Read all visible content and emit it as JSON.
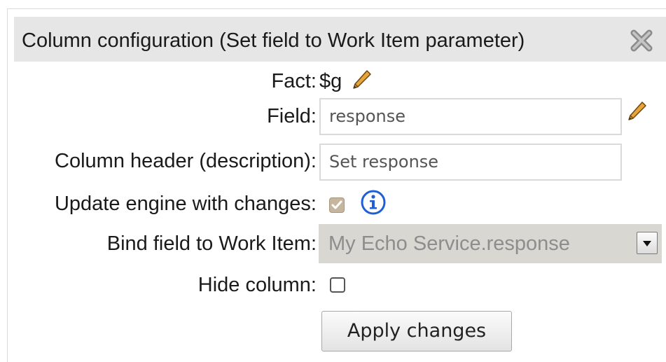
{
  "dialog": {
    "title": "Column configuration (Set field to Work Item parameter)",
    "close_icon": "close-x-icon"
  },
  "fact": {
    "label": "Fact:",
    "value": "$g",
    "edit_icon": "pencil-icon"
  },
  "field": {
    "label": "Field:",
    "value": "response",
    "edit_icon": "pencil-icon"
  },
  "column_header": {
    "label": "Column header (description):",
    "value": "Set response"
  },
  "update_engine": {
    "label": "Update engine with changes:",
    "checked": true,
    "info_icon": "info-icon"
  },
  "bind_field": {
    "label": "Bind field to Work Item:",
    "selected": "My Echo Service.response",
    "arrow_icon": "dropdown-arrow-icon"
  },
  "hide_column": {
    "label": "Hide column:",
    "checked": false
  },
  "apply_button": {
    "label": "Apply changes"
  },
  "colors": {
    "title_bar": "#e6e6e6",
    "disabled_select": "#d9d7d2",
    "info_blue": "#1f5fd6"
  }
}
